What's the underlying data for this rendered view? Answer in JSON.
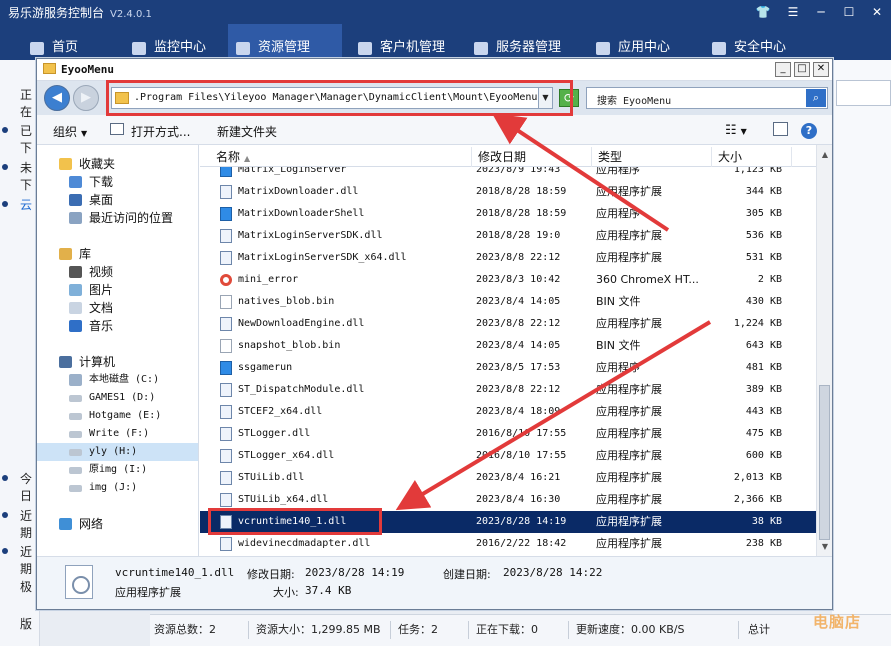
{
  "app": {
    "title": "易乐游服务控制台",
    "version": "V2.4.0.1",
    "nav_tabs": [
      "首页",
      "监控中心",
      "资源管理",
      "客户机管理",
      "服务器管理",
      "应用中心",
      "安全中心"
    ],
    "left_items": [
      "正在",
      "已下",
      "未下",
      "云",
      "今日",
      "近期",
      "近期",
      "极",
      "版"
    ],
    "status": {
      "total": "资源总数：2",
      "size": "资源大小：1,299.85 MB",
      "tasks": "任务：2",
      "downloading": "正在下载：0",
      "speed": "更新速度：0.00 KB/S",
      "total2": "总计"
    },
    "watermark": "电脑店"
  },
  "dialog": {
    "title": "EyooMenu",
    "address": ".Program Files\\Yileyoo Manager\\Manager\\DynamicClient\\Mount\\EyooMenu",
    "search_placeholder": "搜索 EyooMenu",
    "toolbar": {
      "organize": "组织",
      "open_with": "打开方式...",
      "new_folder": "新建文件夹"
    },
    "nav": {
      "favorites": "收藏夹",
      "downloads": "下载",
      "desktop": "桌面",
      "recent": "最近访问的位置",
      "libraries": "库",
      "videos": "视频",
      "pictures": "图片",
      "documents": "文档",
      "music": "音乐",
      "computer": "计算机",
      "drives": [
        "本地磁盘 (C:)",
        "GAMES1 (D:)",
        "Hotgame (E:)",
        "Write (F:)",
        "yly (H:)",
        "原img (I:)",
        "img (J:)"
      ],
      "network": "网络"
    },
    "columns": {
      "name": "名称",
      "date": "修改日期",
      "type": "类型",
      "size": "大小"
    },
    "files": [
      {
        "name": "Matrix_LoginServer",
        "date": "2023/8/9 19:43",
        "type": "应用程序",
        "size": "1,123 KB",
        "icon": "exe"
      },
      {
        "name": "MatrixDownloader.dll",
        "date": "2018/8/28 18:59",
        "type": "应用程序扩展",
        "size": "344 KB",
        "icon": "dll"
      },
      {
        "name": "MatrixDownloaderShell",
        "date": "2018/8/28 18:59",
        "type": "应用程序",
        "size": "305 KB",
        "icon": "exe"
      },
      {
        "name": "MatrixLoginServerSDK.dll",
        "date": "2018/8/28 19:0",
        "type": "应用程序扩展",
        "size": "536 KB",
        "icon": "dll"
      },
      {
        "name": "MatrixLoginServerSDK_x64.dll",
        "date": "2023/8/8 22:12",
        "type": "应用程序扩展",
        "size": "531 KB",
        "icon": "dll"
      },
      {
        "name": "mini_error",
        "date": "2023/8/3 10:42",
        "type": "360 ChromeX HT...",
        "size": "2 KB",
        "icon": "chrome"
      },
      {
        "name": "natives_blob.bin",
        "date": "2023/8/4 14:05",
        "type": "BIN 文件",
        "size": "430 KB",
        "icon": "bin"
      },
      {
        "name": "NewDownloadEngine.dll",
        "date": "2023/8/8 22:12",
        "type": "应用程序扩展",
        "size": "1,224 KB",
        "icon": "dll"
      },
      {
        "name": "snapshot_blob.bin",
        "date": "2023/8/4 14:05",
        "type": "BIN 文件",
        "size": "643 KB",
        "icon": "bin"
      },
      {
        "name": "ssgamerun",
        "date": "2023/8/5 17:53",
        "type": "应用程序",
        "size": "481 KB",
        "icon": "exe"
      },
      {
        "name": "ST_DispatchModule.dll",
        "date": "2023/8/8 22:12",
        "type": "应用程序扩展",
        "size": "389 KB",
        "icon": "dll"
      },
      {
        "name": "STCEF2_x64.dll",
        "date": "2023/8/4 18:09",
        "type": "应用程序扩展",
        "size": "443 KB",
        "icon": "dll"
      },
      {
        "name": "STLogger.dll",
        "date": "2016/8/10 17:55",
        "type": "应用程序扩展",
        "size": "475 KB",
        "icon": "dll"
      },
      {
        "name": "STLogger_x64.dll",
        "date": "2016/8/10 17:55",
        "type": "应用程序扩展",
        "size": "600 KB",
        "icon": "dll"
      },
      {
        "name": "STUiLib.dll",
        "date": "2023/8/4 16:21",
        "type": "应用程序扩展",
        "size": "2,013 KB",
        "icon": "dll"
      },
      {
        "name": "STUiLib_x64.dll",
        "date": "2023/8/4 16:30",
        "type": "应用程序扩展",
        "size": "2,366 KB",
        "icon": "dll"
      },
      {
        "name": "vcruntime140_1.dll",
        "date": "2023/8/28 14:19",
        "type": "应用程序扩展",
        "size": "38 KB",
        "icon": "dll",
        "selected": true
      },
      {
        "name": "widevinecdmadapter.dll",
        "date": "2016/2/22 18:42",
        "type": "应用程序扩展",
        "size": "238 KB",
        "icon": "dll"
      }
    ],
    "details": {
      "name": "vcruntime140_1.dll",
      "modified_label": "修改日期:",
      "modified": "2023/8/28 14:19",
      "created_label": "创建日期:",
      "created": "2023/8/28 14:22",
      "type": "应用程序扩展",
      "size_label": "大小:",
      "size": "37.4 KB"
    }
  },
  "colors": {
    "accent": "#1c3f7c",
    "selection": "#0a2a66",
    "annotation": "#e23a3a"
  }
}
